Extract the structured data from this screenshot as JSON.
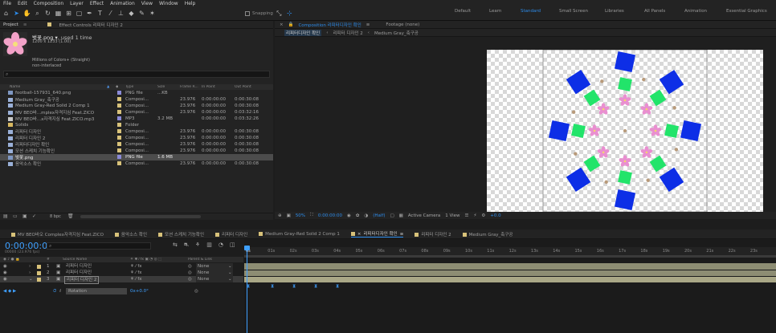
{
  "menu": [
    "File",
    "Edit",
    "Composition",
    "Layer",
    "Effect",
    "Animation",
    "View",
    "Window",
    "Help"
  ],
  "snapping": "Snapping",
  "workspaces": [
    {
      "label": "Default",
      "active": false
    },
    {
      "label": "Learn",
      "active": false
    },
    {
      "label": "Standard",
      "active": true
    },
    {
      "label": "Small Screen",
      "active": false
    },
    {
      "label": "Libraries",
      "active": false
    },
    {
      "label": "All Panels",
      "active": false
    },
    {
      "label": "Animation",
      "active": false
    },
    {
      "label": "Essential Graphics",
      "active": false
    }
  ],
  "project": {
    "tab": "Project",
    "effect_tab": "Effect Controls 리피터 디자인 2",
    "asset": {
      "name": "벚꽃.png ▾",
      "used": ", used 1 time",
      "dims": "1200 x 1233 (1.00)",
      "colors": "Millions of Colors+ (Straight)",
      "interlace": "non-interlaced"
    },
    "columns": [
      "Name",
      "Type",
      "Size",
      "Frame R...",
      "In Point",
      "Out Point"
    ],
    "rows": [
      {
        "name": "football-157931_640.png",
        "type": "PNG file",
        "size": "...KB",
        "fr": "",
        "in": "",
        "out": "",
        "icon": "#7e97c2",
        "label": "#8a8ad8",
        "sel": false
      },
      {
        "name": "Medium Gray_축구공",
        "type": "Composi...",
        "size": "",
        "fr": "23.976",
        "in": "0:00:00:00",
        "out": "0:00:30:08",
        "icon": "#9ab0d8",
        "label": "#d8c27a",
        "sel": false
      },
      {
        "name": "Medium Gray-Red Solid 2 Comp 1",
        "type": "Composi...",
        "size": "",
        "fr": "23.976",
        "in": "0:00:00:00",
        "out": "0:00:30:08",
        "icon": "#9ab0d8",
        "label": "#d8c27a",
        "sel": false
      },
      {
        "name": "MV BEO바...mplex자격지심 Feat.ZICO",
        "type": "Composi...",
        "size": "",
        "fr": "23.976",
        "in": "0:00:00:00",
        "out": "0:03:32:16",
        "icon": "#9ab0d8",
        "label": "#d8c27a",
        "sel": false
      },
      {
        "name": "MV BEO바...x자격지심 Feat.ZICO.mp3",
        "type": "MP3",
        "size": "3.2 MB",
        "fr": "",
        "in": "0:00:00:00",
        "out": "0:03:32:26",
        "icon": "#c8c8c8",
        "label": "#8a8ad8",
        "sel": false
      },
      {
        "name": "Solids",
        "type": "Folder",
        "size": "",
        "fr": "",
        "in": "",
        "out": "",
        "icon": "#d8b860",
        "label": "#d8c27a",
        "sel": false
      },
      {
        "name": "리피터 디자인",
        "type": "Composi...",
        "size": "",
        "fr": "23.976",
        "in": "0:00:00:00",
        "out": "0:00:30:08",
        "icon": "#9ab0d8",
        "label": "#d8c27a",
        "sel": false
      },
      {
        "name": "리피터 디자인 2",
        "type": "Composi...",
        "size": "",
        "fr": "23.976",
        "in": "0:00:00:00",
        "out": "0:00:30:08",
        "icon": "#9ab0d8",
        "label": "#d8c27a",
        "sel": false
      },
      {
        "name": "리피터디자인 확인",
        "type": "Composi...",
        "size": "",
        "fr": "23.976",
        "in": "0:00:00:00",
        "out": "0:00:30:08",
        "icon": "#9ab0d8",
        "label": "#d8c27a",
        "sel": false
      },
      {
        "name": "모션 스케치 기능확인",
        "type": "Composi...",
        "size": "",
        "fr": "23.976",
        "in": "0:00:00:00",
        "out": "0:00:30:08",
        "icon": "#9ab0d8",
        "label": "#d8c27a",
        "sel": false
      },
      {
        "name": "벚꽃.png",
        "type": "PNG file",
        "size": "1.6 MB",
        "fr": "",
        "in": "",
        "out": "",
        "icon": "#7e97c2",
        "label": "#8a8ad8",
        "sel": true
      },
      {
        "name": "음악소스 확인",
        "type": "Composi...",
        "size": "",
        "fr": "23.976",
        "in": "0:00:00:00",
        "out": "0:00:30:08",
        "icon": "#9ab0d8",
        "label": "#d8c27a",
        "sel": false
      }
    ],
    "bpc": "8 bpc"
  },
  "comp": {
    "tab": "Composition 리피터디자인 확인",
    "footage": "Footage (none)",
    "breadcrumbs": [
      "리피터디자인 확인",
      "리피터 디자인 2",
      "Medium Gray_축구공"
    ],
    "zoom": "50%",
    "time": "0:00:00:00",
    "resolution": "(Half)",
    "camera": "Active Camera",
    "view": "1 View",
    "exposure": "+0.0"
  },
  "timeline": {
    "tabs": [
      {
        "label": "MV BEO바오 Complex자격지심 Feat.ZICO",
        "color": "#d8c27a",
        "active": false
      },
      {
        "label": "음악소스 확인",
        "color": "#d8c27a",
        "active": false
      },
      {
        "label": "모션 스케치 기능확인",
        "color": "#d8c27a",
        "active": false
      },
      {
        "label": "리피터 디자인",
        "color": "#d8c27a",
        "active": false
      },
      {
        "label": "Medium Gray-Red Solid 2 Comp 1",
        "color": "#d8c27a",
        "active": false
      },
      {
        "label": "리피터디자인 확인",
        "color": "#d8c27a",
        "active": true
      },
      {
        "label": "리피터 디자인 2",
        "color": "#d8c27a",
        "active": false
      },
      {
        "label": "Medium Gray_축구공",
        "color": "#d8c27a",
        "active": false
      }
    ],
    "timecode": "0:00:00:00",
    "fps": "00000 (23.976 fps)",
    "col_num": "#",
    "col_source": "Source Name",
    "col_parent": "Parent & Link",
    "layers": [
      {
        "num": "1",
        "name": "리피터 디자인",
        "parent": "None",
        "sel": false
      },
      {
        "num": "2",
        "name": "리피터 디자인",
        "parent": "None",
        "sel": false
      },
      {
        "num": "3",
        "name": "리피터 디자인 2",
        "parent": "None",
        "sel": true
      }
    ],
    "prop": {
      "name": "Rotation",
      "value": "0x+0.0°"
    },
    "ruler": [
      "0s",
      "01s",
      "02s",
      "03s",
      "04s",
      "05s",
      "06s",
      "07s",
      "08s",
      "09s",
      "10s",
      "11s",
      "12s",
      "13s",
      "14s",
      "15s",
      "16s",
      "17s",
      "18s",
      "19s",
      "20s",
      "21s",
      "22s",
      "23s"
    ]
  }
}
